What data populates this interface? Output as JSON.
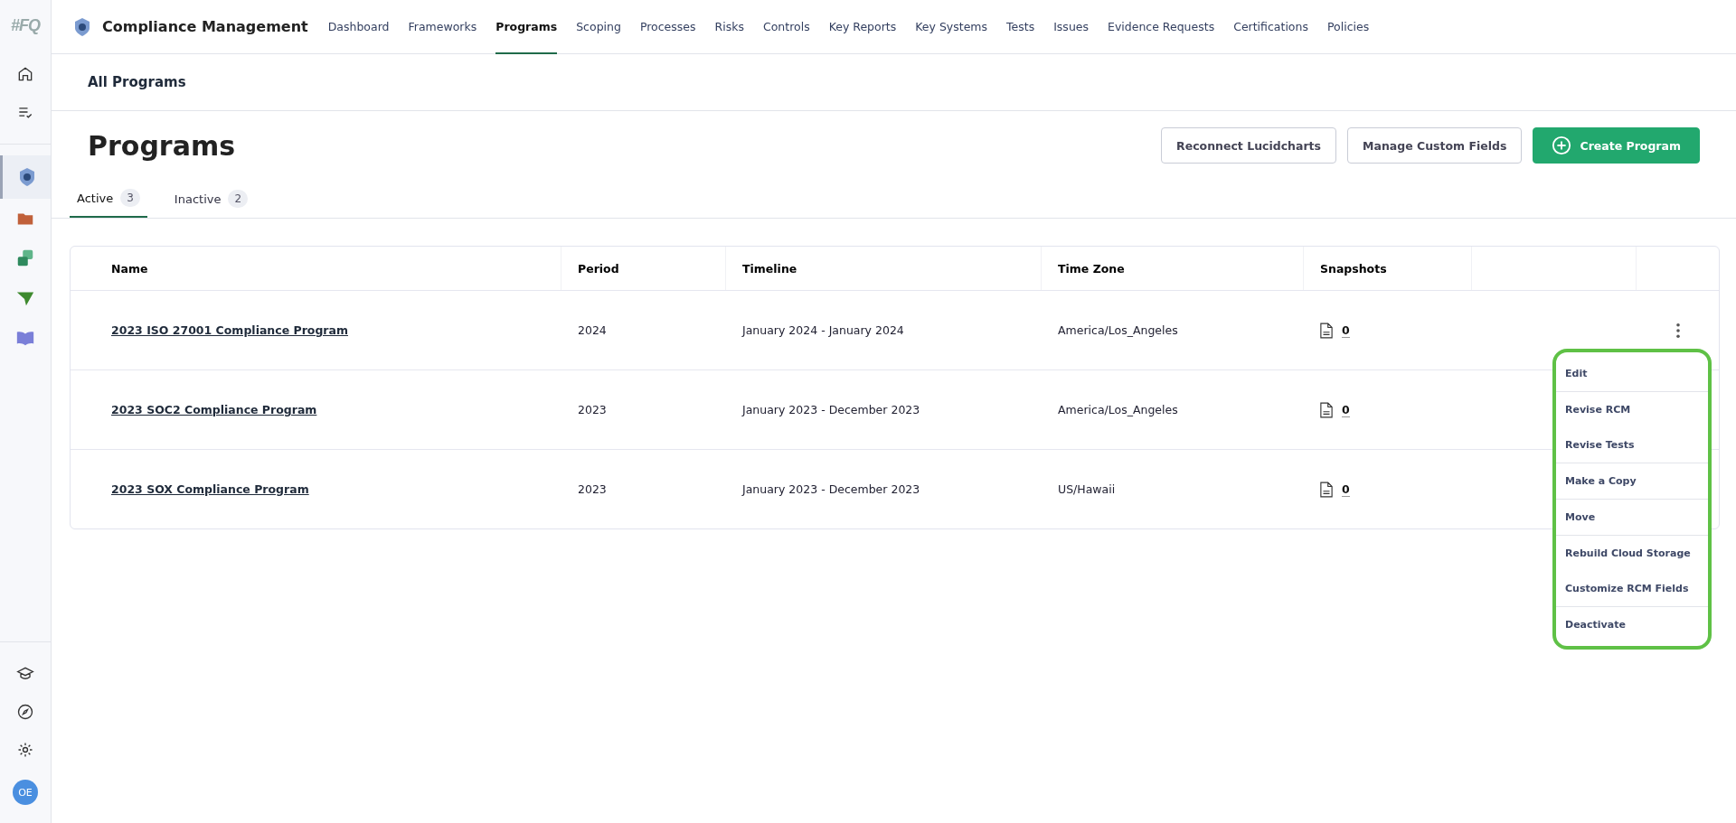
{
  "app": {
    "logo": "#FQ",
    "title": "Compliance Management",
    "avatar": "OE"
  },
  "nav": [
    {
      "label": "Dashboard",
      "selected": false
    },
    {
      "label": "Frameworks",
      "selected": false
    },
    {
      "label": "Programs",
      "selected": true
    },
    {
      "label": "Scoping",
      "selected": false
    },
    {
      "label": "Processes",
      "selected": false
    },
    {
      "label": "Risks",
      "selected": false
    },
    {
      "label": "Controls",
      "selected": false
    },
    {
      "label": "Key Reports",
      "selected": false
    },
    {
      "label": "Key Systems",
      "selected": false
    },
    {
      "label": "Tests",
      "selected": false
    },
    {
      "label": "Issues",
      "selected": false
    },
    {
      "label": "Evidence Requests",
      "selected": false
    },
    {
      "label": "Certifications",
      "selected": false
    },
    {
      "label": "Policies",
      "selected": false
    }
  ],
  "breadcrumb": "All Programs",
  "page_title": "Programs",
  "actions": [
    {
      "label": "Reconnect Lucidcharts",
      "kind": "outline"
    },
    {
      "label": "Manage Custom Fields",
      "kind": "outline"
    },
    {
      "label": "Create Program",
      "kind": "primary"
    }
  ],
  "tabs": [
    {
      "label": "Active",
      "count": "3",
      "selected": true
    },
    {
      "label": "Inactive",
      "count": "2",
      "selected": false
    }
  ],
  "table": {
    "columns": [
      "Name",
      "Period",
      "Timeline",
      "Time Zone",
      "Snapshots"
    ],
    "rows": [
      {
        "name": "2023 ISO 27001 Compliance Program",
        "period": "2024",
        "timeline": "January 2024 - January 2024",
        "time_zone": "America/Los_Angeles",
        "snapshots": "0",
        "menu_open": true
      },
      {
        "name": "2023 SOC2 Compliance Program",
        "period": "2023",
        "timeline": "January 2023 - December 2023",
        "time_zone": "America/Los_Angeles",
        "snapshots": "0",
        "menu_open": false
      },
      {
        "name": "2023 SOX Compliance Program",
        "period": "2023",
        "timeline": "January 2023 - December 2023",
        "time_zone": "US/Hawaii",
        "snapshots": "0",
        "menu_open": false
      }
    ]
  },
  "row_menu": {
    "groups": [
      [
        "Edit"
      ],
      [
        "Revise RCM",
        "Revise Tests"
      ],
      [
        "Make a Copy"
      ],
      [
        "Move"
      ],
      [
        "Rebuild Cloud Storage",
        "Customize RCM Fields"
      ],
      [
        "Deactivate"
      ]
    ]
  }
}
